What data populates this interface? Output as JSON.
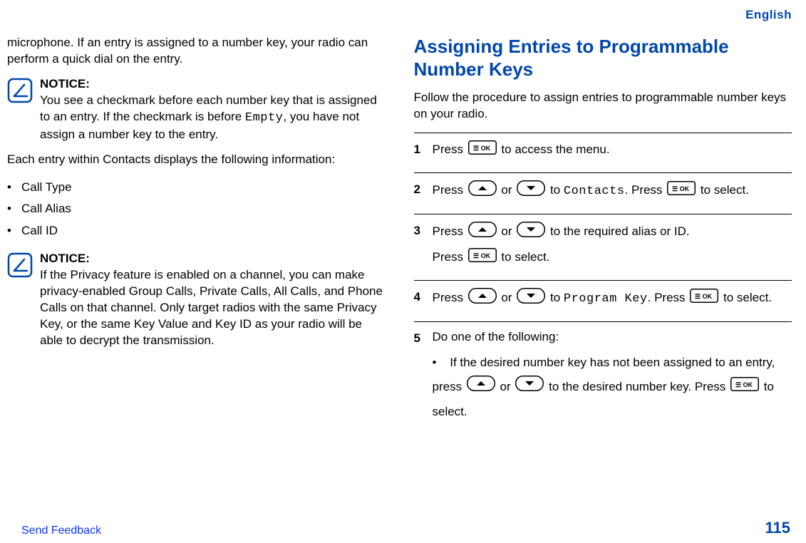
{
  "header": {
    "language": "English"
  },
  "left": {
    "intro": "microphone. If an entry is assigned to a number key, your radio can perform a quick dial on the entry.",
    "notice1": {
      "title": "NOTICE:",
      "pre": "You see a checkmark before each number key that is assigned to an entry. If the checkmark is before ",
      "code": "Empty",
      "post": ", you have not assign a number key to the entry."
    },
    "infoIntro": "Each entry within Contacts displays the following information:",
    "infoList": [
      "Call Type",
      "Call Alias",
      "Call ID"
    ],
    "notice2": {
      "title": "NOTICE:",
      "text": "If the Privacy feature is enabled on a channel, you can make privacy-enabled Group Calls, Private Calls, All Calls, and Phone Calls on that channel. Only target radios with the same Privacy Key, or the same Key Value and Key ID as your radio will be able to decrypt the transmission."
    }
  },
  "right": {
    "heading": "Assigning Entries to Programmable Number Keys",
    "intro": "Follow the procedure to assign entries to programmable number keys on your radio.",
    "steps": {
      "s1_a": "Press ",
      "s1_b": " to access the menu.",
      "s2_a": "Press ",
      "s2_b": " or ",
      "s2_c": " to ",
      "s2_code": "Contacts",
      "s2_d": ". Press ",
      "s2_e": " to select.",
      "s3_a": "Press ",
      "s3_b": " or ",
      "s3_c": " to the required alias or ID.",
      "s3_d": "Press ",
      "s3_e": " to select.",
      "s4_a": "Press ",
      "s4_b": " or ",
      "s4_c": " to ",
      "s4_code": "Program Key",
      "s4_d": ". Press ",
      "s4_e": " to select.",
      "s5_intro": "Do one of the following:",
      "s5_li_a": "If the desired number key has not been assigned to an entry, press ",
      "s5_li_b": " or ",
      "s5_li_c": " to the desired number key. Press ",
      "s5_li_d": " to select."
    }
  },
  "footer": {
    "feedback": "Send Feedback",
    "pageNumber": "115"
  }
}
